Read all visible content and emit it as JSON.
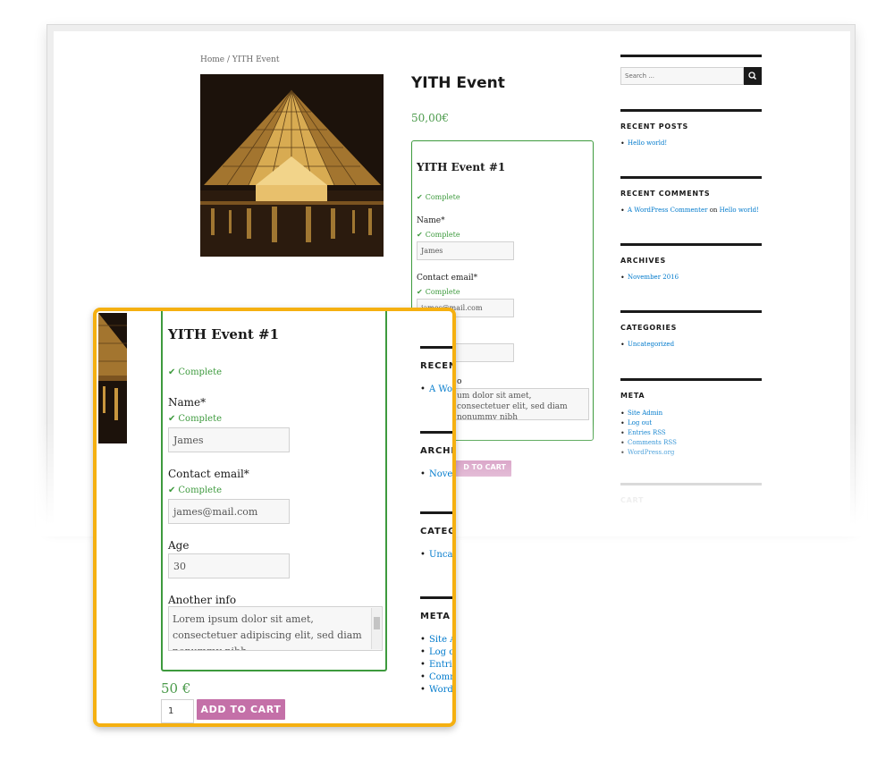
{
  "background_page": {
    "breadcrumb": "Home / YITH Event",
    "product_title": "YITH Event",
    "price": "50,00€",
    "event_box": {
      "title": "YITH Event #1",
      "status_complete": "Complete",
      "name_label": "Name*",
      "name_value": "James",
      "email_label": "Contact email*",
      "email_value": "james@mail.com",
      "another_info_label": "o",
      "textarea_text": "um dolor sit amet, consectetuer elit, sed diam nonummy nibh"
    },
    "add_to_cart_label": "D TO CART"
  },
  "sidebar": {
    "search_placeholder": "Search ...",
    "recent_posts": {
      "title": "RECENT POSTS",
      "items": [
        "Hello world!"
      ]
    },
    "recent_comments": {
      "title": "RECENT COMMENTS",
      "author": "A WordPress Commenter",
      "on": "on",
      "post": "Hello world!"
    },
    "archives": {
      "title": "ARCHIVES",
      "items": [
        "November 2016"
      ]
    },
    "categories": {
      "title": "CATEGORIES",
      "items": [
        "Uncategorized"
      ]
    },
    "meta": {
      "title": "META",
      "items": [
        "Site Admin",
        "Log out",
        "Entries RSS",
        "Comments RSS",
        "WordPress.org"
      ]
    },
    "cart": {
      "title": "CART"
    }
  },
  "zoom": {
    "title": "YITH Event #1",
    "status_complete": "Complete",
    "name_label": "Name*",
    "name_value": "James",
    "email_label": "Contact email*",
    "email_value": "james@mail.com",
    "age_label": "Age",
    "age_value": "30",
    "another_info_label": "Another info",
    "textarea_text": "Lorem ipsum dolor sit amet, consectetuer adipiscing elit, sed diam nonummy nibh",
    "price": "50 €",
    "quantity": "1",
    "add_to_cart_label": "ADD TO CART",
    "side": {
      "recent_head": "RECEN",
      "recent_item": "A Wor",
      "archives_head": "ARCHI",
      "archives_item": "Novem",
      "categories_head": "CATEG",
      "categories_item": "Uncat",
      "meta_head": "META",
      "meta_items": [
        "Site A",
        "Log ou",
        "Entrie",
        "Comm",
        "WordP"
      ]
    }
  },
  "colors": {
    "accent_green": "#3d9a3d",
    "button_pink": "#c470a8",
    "highlight_orange": "#f5b011",
    "link_blue": "#007acc"
  }
}
